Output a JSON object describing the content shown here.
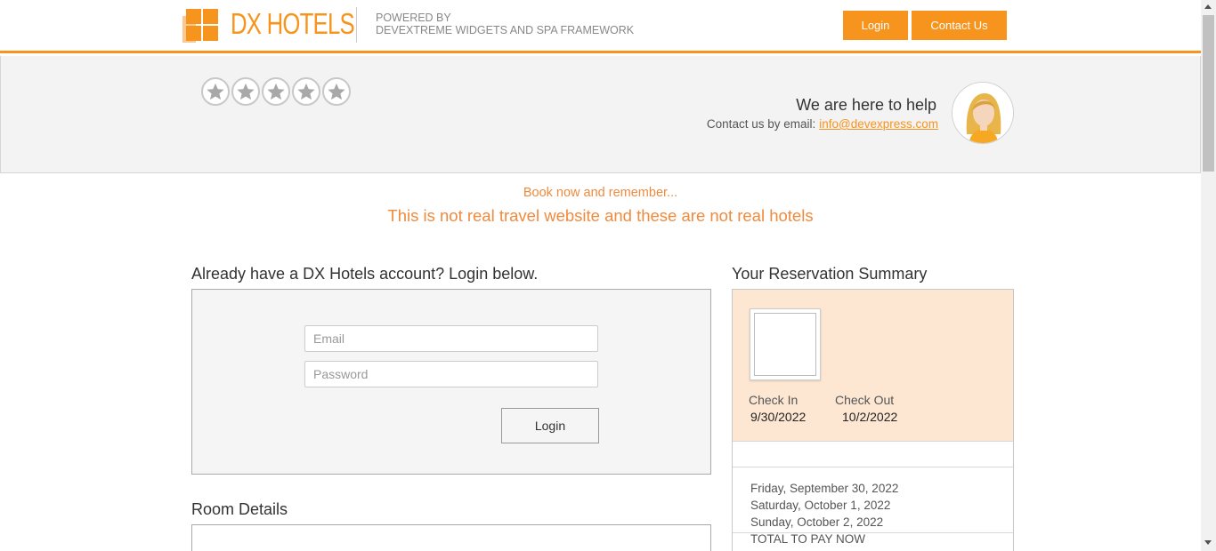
{
  "header": {
    "brand": "DX HOTELS",
    "powered_line1": "POWERED BY",
    "powered_line2": "DEVEXTREME WIDGETS AND SPA FRAMEWORK",
    "login_label": "Login",
    "contact_label": "Contact Us",
    "accent_color": "#f7941d"
  },
  "help": {
    "rating_stars": 5,
    "title": "We are here to help",
    "contact_text": "Contact us by email:",
    "email": "info@devexpress.com"
  },
  "notice": {
    "line1": "Book now and remember...",
    "line2": "This is not real travel website and these are not real hotels"
  },
  "login": {
    "heading": "Already have a DX Hotels account? Login below.",
    "email_placeholder": "Email",
    "password_placeholder": "Password",
    "button_label": "Login"
  },
  "room": {
    "heading": "Room Details"
  },
  "summary": {
    "heading": "Your Reservation Summary",
    "checkin_label": "Check In",
    "checkin_value": "9/30/2022",
    "checkout_label": "Check Out",
    "checkout_value": "10/2/2022",
    "days": [
      "Friday, September 30, 2022",
      "Saturday, October 1, 2022",
      "Sunday, October 2, 2022"
    ],
    "total_label": "TOTAL TO PAY NOW"
  }
}
